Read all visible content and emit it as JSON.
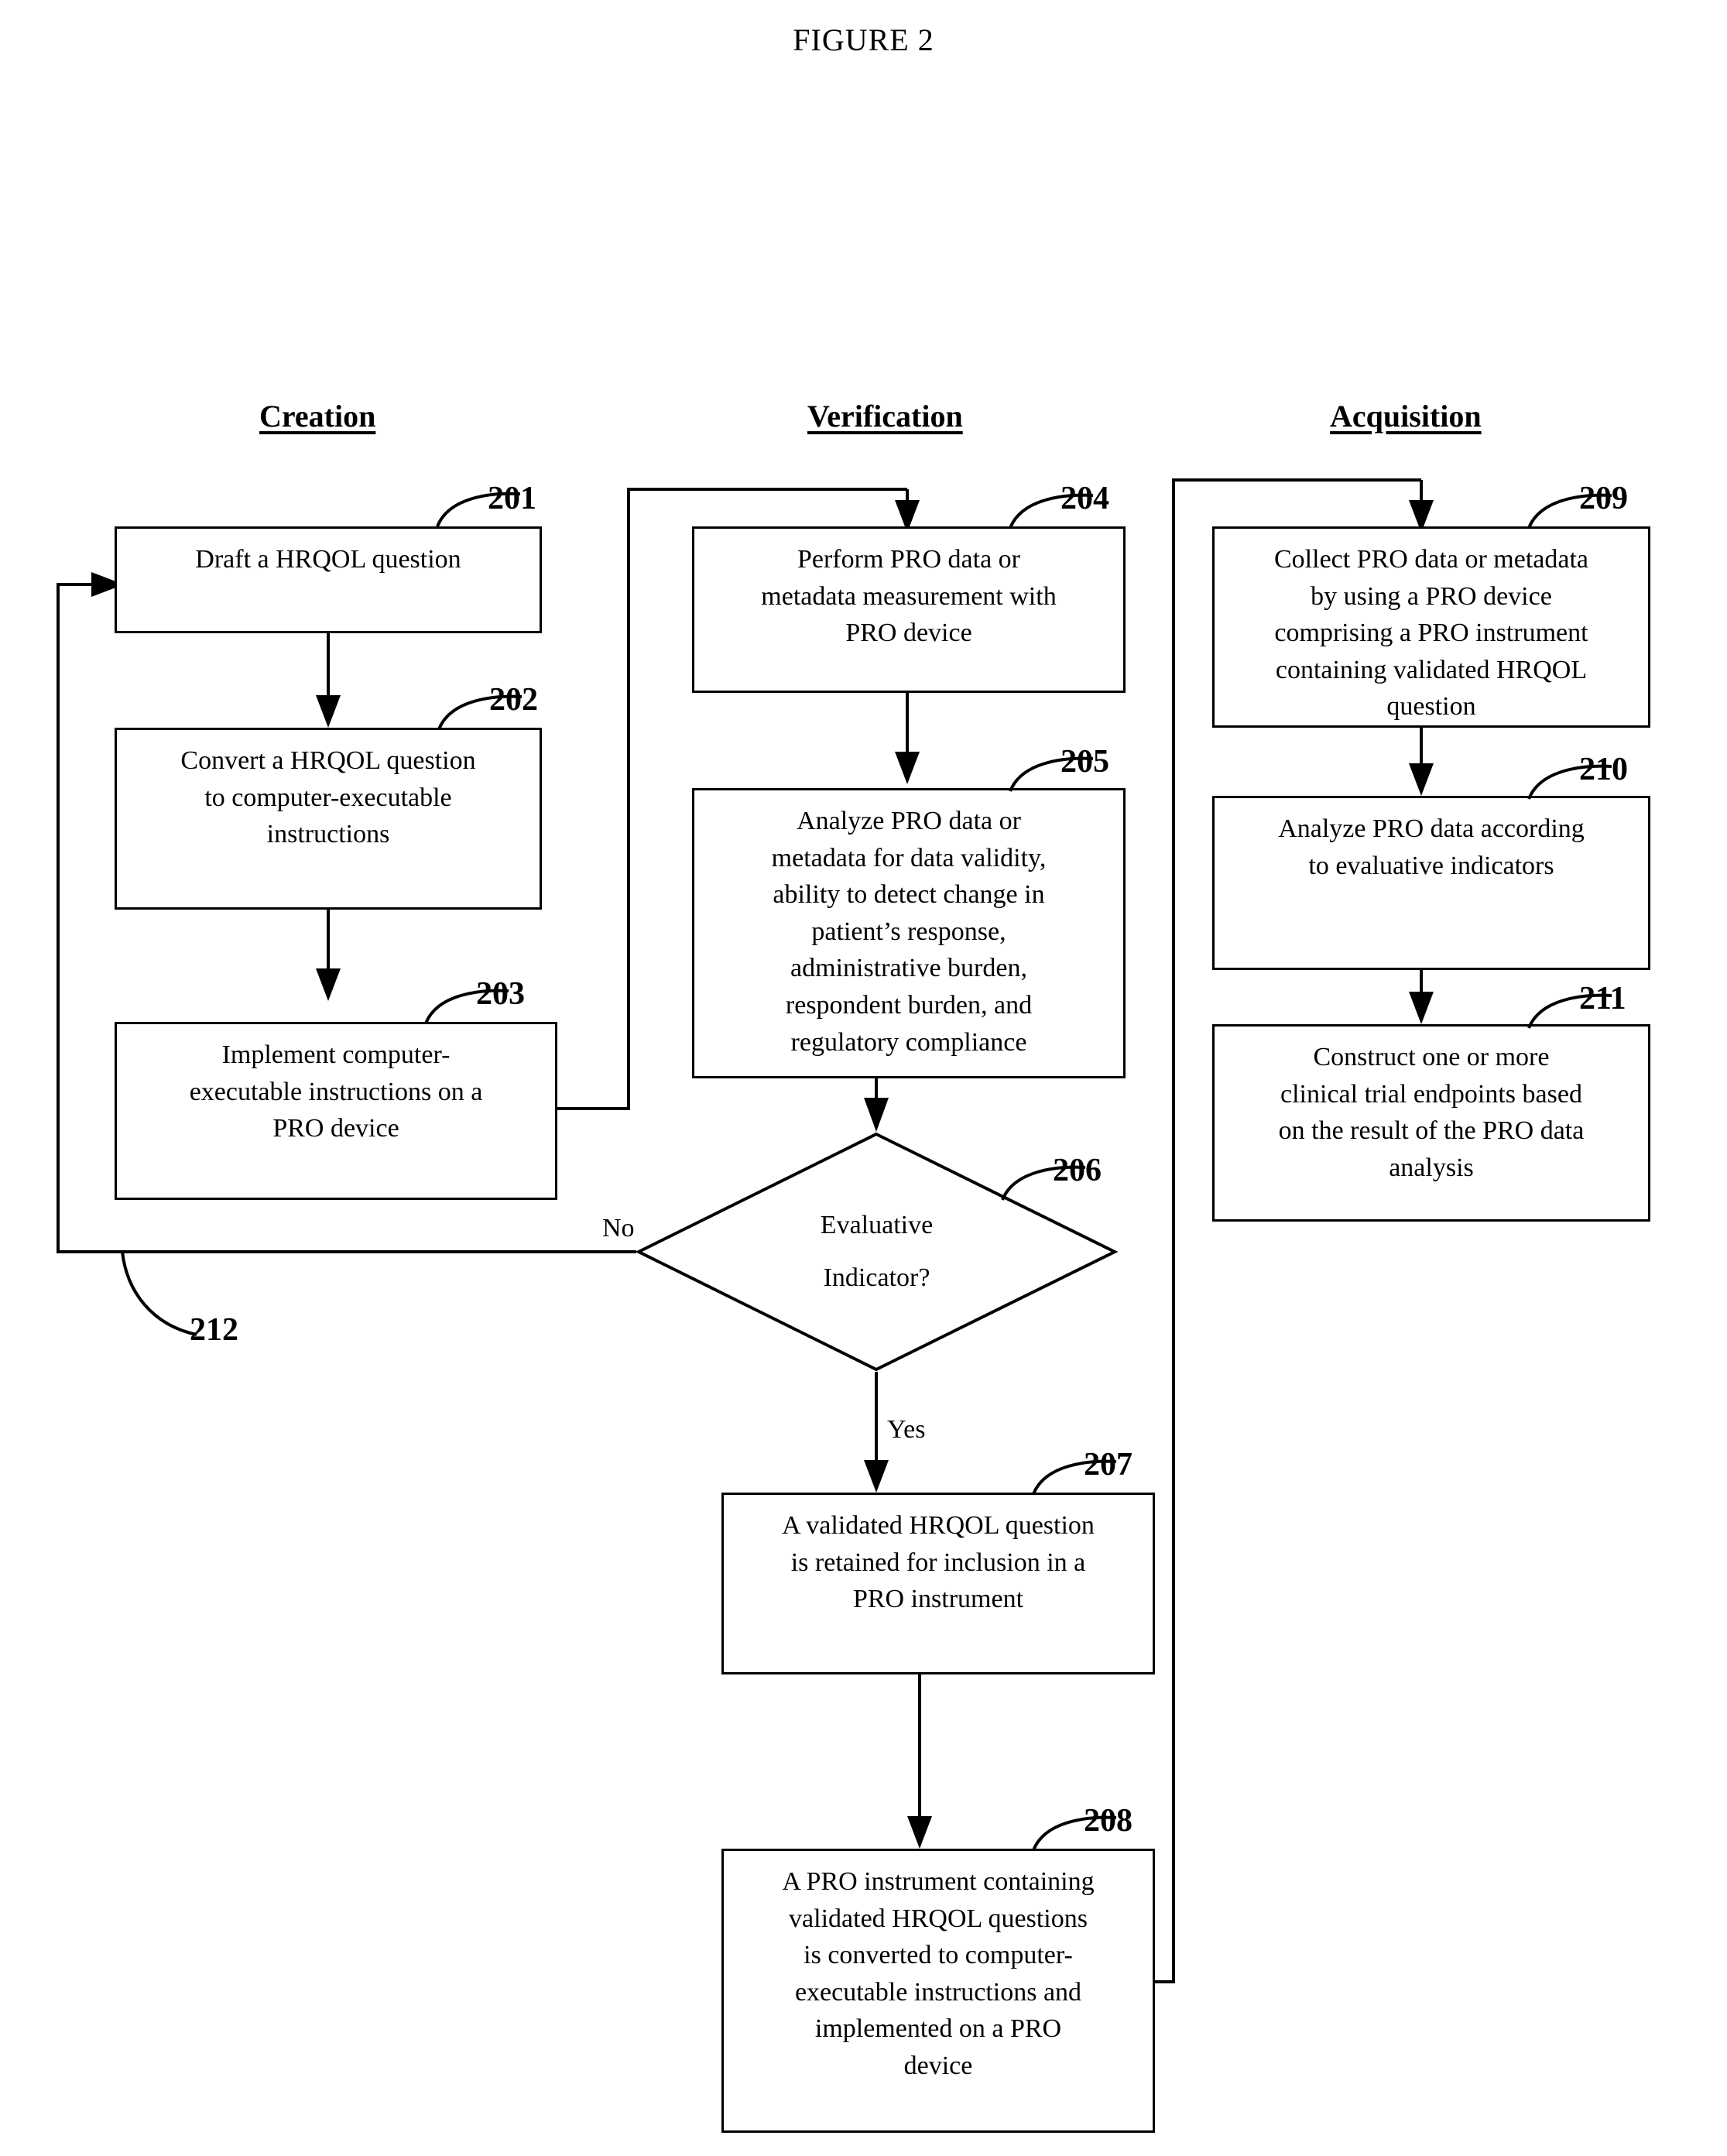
{
  "figure": {
    "title": "FIGURE 2"
  },
  "columns": [
    {
      "id": "creation",
      "label": "Creation"
    },
    {
      "id": "verification",
      "label": "Verification"
    },
    {
      "id": "acquisition",
      "label": "Acquisition"
    }
  ],
  "nodes": {
    "n201": {
      "ref": "201",
      "text": "Draft a HRQOL question"
    },
    "n202": {
      "ref": "202",
      "text": "Convert a HRQOL question\nto computer-executable\ninstructions"
    },
    "n203": {
      "ref": "203",
      "text": "Implement computer-\nexecutable instructions on a\nPRO device"
    },
    "n204": {
      "ref": "204",
      "text": "Perform PRO data  or\nmetadata measurement with\nPRO device"
    },
    "n205": {
      "ref": "205",
      "text": "Analyze PRO data or\nmetadata for data validity,\nability to detect change in\npatient’s response,\nadministrative burden,\nrespondent burden, and\nregulatory compliance"
    },
    "n206": {
      "ref": "206",
      "text_line1": "Evaluative",
      "text_line2": "Indicator?"
    },
    "n207": {
      "ref": "207",
      "text": "A validated HRQOL question\nis retained for inclusion in a\nPRO instrument"
    },
    "n208": {
      "ref": "208",
      "text": "A PRO instrument containing\nvalidated HRQOL questions\nis converted to computer-\nexecutable instructions and\nimplemented on a PRO\ndevice"
    },
    "n209": {
      "ref": "209",
      "text": "Collect PRO data or metadata\nby using a PRO device\ncomprising a PRO instrument\ncontaining validated HRQOL\nquestion"
    },
    "n210": {
      "ref": "210",
      "text": "Analyze PRO data according\nto evaluative indicators"
    },
    "n211": {
      "ref": "211",
      "text": "Construct one or more\nclinical trial endpoints based\non the result of the PRO data\nanalysis"
    }
  },
  "feedback": {
    "ref": "212"
  },
  "branch_labels": {
    "no": "No",
    "yes": "Yes"
  },
  "colors": {
    "ink": "#000000",
    "paper": "#ffffff"
  }
}
